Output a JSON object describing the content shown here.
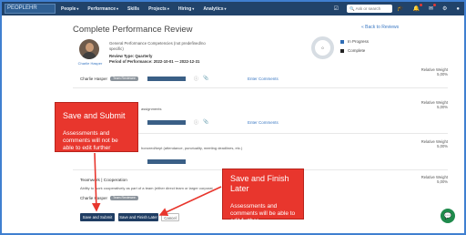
{
  "nav": {
    "logo": "PEOPLEHR",
    "items": [
      "People",
      "Performance",
      "Skills",
      "Projects",
      "Hiring",
      "Analytics"
    ],
    "search_placeholder": "Ask or search"
  },
  "page": {
    "title": "Complete Performance Review",
    "back_link": "Back to Reviews"
  },
  "review": {
    "employee_name": "Charlie Hasper",
    "competencies": "General Performance Competencies (not predefined/no specific)",
    "review_type": "Review Type: Quarterly",
    "period": "Period of Performance: 2022-10-01 — 2022-12-31",
    "progress_value": "0"
  },
  "legend": {
    "in_progress": "In Progress",
    "complete": "Complete",
    "in_progress_color": "#2f6db5",
    "complete_color": "#222222"
  },
  "reviewers": {
    "name": "Charlie Hasper",
    "badge": "Team Reviewee"
  },
  "sections": [
    {
      "desc": "assignments",
      "weight_label": "Relative Weight",
      "weight": "5,00%",
      "comments": "Enter Comments"
    },
    {
      "desc": "honored/kept (attendance, punctuality, meeting deadlines, etc.)",
      "weight_label": "Relative Weight",
      "weight": "5,00%"
    },
    {
      "title": "Teamwork | Cooperation",
      "desc": "Ability to work cooperatively as part of a team (either direct team or larger corporat",
      "weight_label": "Relative Weight",
      "weight": "5,00%"
    }
  ],
  "first_weight": {
    "label": "Relative Weight",
    "value": "5,00%"
  },
  "first_comments": "Enter Comments",
  "callouts": {
    "submit_title": "Save and Submit",
    "submit_body": "Assessments and comments will not be able to edit further",
    "later_title": "Save and Finish Later",
    "later_body": "Assessments and comments will be able to edit further"
  },
  "buttons": {
    "submit": "Save and Submit",
    "later": "Save and Finish Later",
    "cancel": "Cancel"
  },
  "colors": {
    "nav_bg": "#21436a",
    "callout_bg": "#e8362d",
    "button_bg": "#1f3d63",
    "link": "#3a78c3",
    "chat": "#1f8a4c"
  }
}
